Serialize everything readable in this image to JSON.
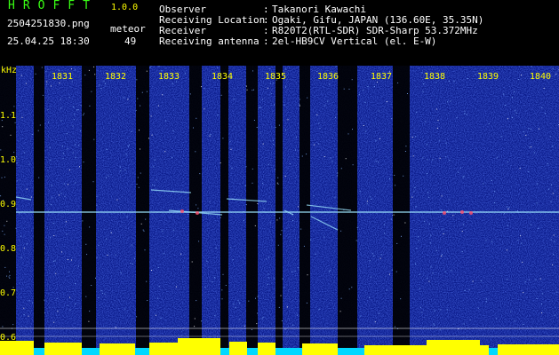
{
  "app": {
    "title": "HROFFT",
    "version": "1.0.0"
  },
  "file": {
    "name": "2504251830.png",
    "datetime": "25.04.25 18:30"
  },
  "meteor": {
    "label": "meteor",
    "count": "49"
  },
  "info": [
    {
      "label": "Observer",
      "value": "Takanori Kawachi"
    },
    {
      "label": "Receiving Location",
      "value": "Ogaki, Gifu, JAPAN (136.60E, 35.35N)"
    },
    {
      "label": "Receiver",
      "value": "R820T2(RTL-SDR) SDR-Sharp 53.372MHz"
    },
    {
      "label": "Receiving antenna",
      "value": "2el-HB9CV Vertical (el. E-W)"
    }
  ],
  "axis": {
    "unit": "kHz",
    "y_ticks": [
      "1.1",
      "1.0",
      "0.9",
      "0.8",
      "0.7",
      "0.6"
    ],
    "x_ticks": [
      "1831",
      "1832",
      "1833",
      "1834",
      "1835",
      "1836",
      "1837",
      "1838",
      "1839",
      "1840"
    ]
  },
  "colors": {
    "background": "#000000",
    "spectrum": "#0a1a8a",
    "title": "#39ff14",
    "axis_labels": "#ffff00",
    "signal": "#9fe8ff",
    "meter": "#ffff00",
    "meter_base": "#00d8ff"
  }
}
